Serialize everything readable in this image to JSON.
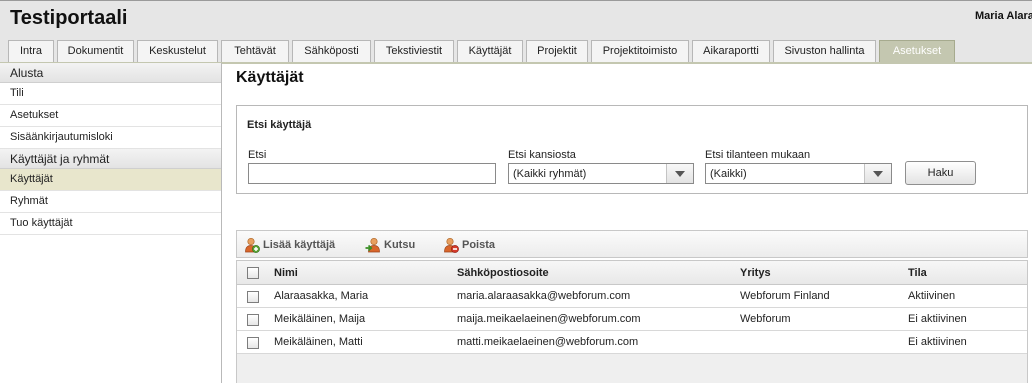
{
  "app": {
    "title": "Testiportaali",
    "user": "Maria Alaraasakka"
  },
  "tabs": [
    {
      "label": "Intra"
    },
    {
      "label": "Dokumentit"
    },
    {
      "label": "Keskustelut"
    },
    {
      "label": "Tehtävät"
    },
    {
      "label": "Sähköposti"
    },
    {
      "label": "Tekstiviestit"
    },
    {
      "label": "Käyttäjät"
    },
    {
      "label": "Projektit"
    },
    {
      "label": "Projektitoimisto"
    },
    {
      "label": "Aikaraportti"
    },
    {
      "label": "Sivuston hallinta"
    },
    {
      "label": "Asetukset",
      "active": true
    }
  ],
  "sidebar": {
    "sections": [
      {
        "title": "Alusta",
        "items": [
          "Tili",
          "Asetukset",
          "Sisäänkirjautumisloki"
        ]
      },
      {
        "title": "Käyttäjät ja ryhmät",
        "items": [
          "Käyttäjät",
          "Ryhmät",
          "Tuo käyttäjät"
        ]
      }
    ],
    "active_item": "Käyttäjät"
  },
  "page": {
    "title": "Käyttäjät"
  },
  "search": {
    "title": "Etsi käyttäjä",
    "text_label": "Etsi",
    "text_value": "",
    "folder_label": "Etsi kansiosta",
    "folder_value": "(Kaikki ryhmät)",
    "status_label": "Etsi tilanteen mukaan",
    "status_value": "(Kaikki)",
    "button": "Haku"
  },
  "toolbar": {
    "add": {
      "label": "Lisää käyttäjä",
      "icon": "add-user-icon"
    },
    "invite": {
      "label": "Kutsu",
      "icon": "invite-user-icon"
    },
    "delete": {
      "label": "Poista",
      "icon": "delete-user-icon"
    }
  },
  "table": {
    "columns": [
      "Nimi",
      "Sähköpostiosoite",
      "Yritys",
      "Tila"
    ],
    "rows": [
      {
        "name": "Alaraasakka, Maria",
        "email": "maria.alaraasakka@webforum.com",
        "company": "Webforum Finland",
        "status": "Aktiivinen"
      },
      {
        "name": "Meikäläinen, Maija",
        "email": "maija.meikaelaeinen@webforum.com",
        "company": "Webforum",
        "status": "Ei aktiivinen"
      },
      {
        "name": "Meikäläinen, Matti",
        "email": "matti.meikaelaeinen@webforum.com",
        "company": "",
        "status": "Ei aktiivinen"
      }
    ]
  },
  "colors": {
    "accent": "#c4c7b0",
    "active_item": "#e8e6cc",
    "header_bg": "#e6e6e6"
  }
}
